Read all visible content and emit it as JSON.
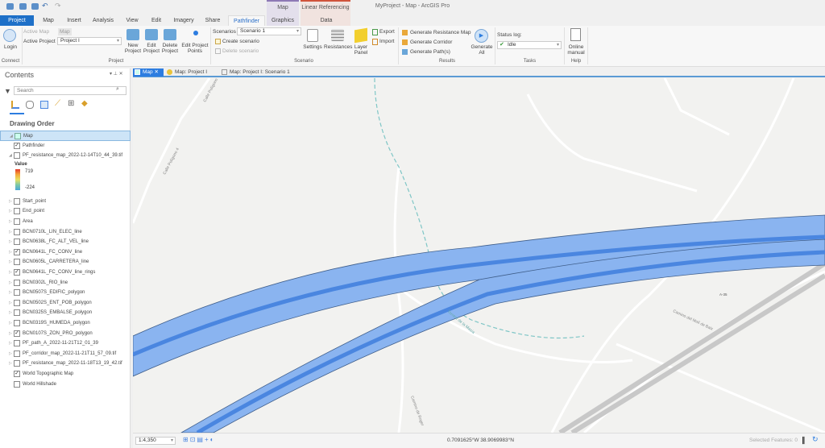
{
  "window": {
    "title": "MyProject - Map - ArcGIS Pro"
  },
  "ribbon_tabs": [
    "Project",
    "Map",
    "Insert",
    "Analysis",
    "View",
    "Edit",
    "Imagery",
    "Share",
    "Pathfinder",
    "Graphics",
    "Data"
  ],
  "contextual": {
    "map": "Map",
    "linear_referencing": "Linear Referencing"
  },
  "ribbon": {
    "connect": {
      "login": "Login",
      "group": "Connect"
    },
    "project": {
      "active_map_label": "Active Map",
      "active_map_value": "Map",
      "active_project_label": "Active Project",
      "active_project_value": "Project I",
      "new": "New Project",
      "edit": "Edit Project",
      "delete": "Delete Project",
      "edit_points": "Edit Project Points",
      "group": "Project"
    },
    "scenario": {
      "scenarios_label": "Scenarios",
      "scenarios_value": "Scenario 1",
      "create": "Create scenario",
      "delete": "Delete scenario",
      "settings": "Settings",
      "resistances": "Resistances",
      "layer_panel": "Layer Panel",
      "export": "Export",
      "import": "Import",
      "group": "Scenario"
    },
    "results": {
      "resistance": "Generate Resistance Map",
      "corridor": "Generate Corridor",
      "paths": "Generate Path(s)",
      "generate_all": "Generate All",
      "group": "Results"
    },
    "tasks": {
      "status_label": "Status log:",
      "status_value": "Idle",
      "group": "Tasks"
    },
    "help": {
      "manual": "Online manual",
      "group": "Help"
    }
  },
  "doc_tabs": [
    "Map",
    "Map: Project I",
    "Map: Project I: Scenario 1"
  ],
  "contents": {
    "title": "Contents",
    "search_placeholder": "Search",
    "drawing_order": "Drawing Order",
    "legend": {
      "title": "Value",
      "high": "719",
      "low": "-224"
    },
    "layers": [
      {
        "name": "Map",
        "checked": null
      },
      {
        "name": "Pathfinder",
        "checked": true
      },
      {
        "name": "PF_resistance_map_2022-12-14T10_44_39.tif",
        "checked": false
      },
      {
        "name": "Start_point",
        "checked": false
      },
      {
        "name": "End_point",
        "checked": false
      },
      {
        "name": "Area",
        "checked": false
      },
      {
        "name": "BCN0710L_LIN_ELEC_line",
        "checked": false
      },
      {
        "name": "BCN0638L_FC_ALT_VEL_line",
        "checked": false
      },
      {
        "name": "BCN0641L_FC_CONV_line",
        "checked": true
      },
      {
        "name": "BCN0605L_CARRETERA_line",
        "checked": false
      },
      {
        "name": "BCN0641L_FC_CONV_line_rings",
        "checked": true
      },
      {
        "name": "BCN0302L_RIO_line",
        "checked": false
      },
      {
        "name": "BCN0507S_EDIFIC_polygon",
        "checked": false
      },
      {
        "name": "BCN0502S_ENT_POB_polygon",
        "checked": false
      },
      {
        "name": "BCN0325S_EMBALSE_polygon",
        "checked": false
      },
      {
        "name": "BCN0319S_HUMEDA_polygon",
        "checked": false
      },
      {
        "name": "BCN0107S_ZON_PRO_polygon",
        "checked": true
      },
      {
        "name": "PF_path_A_2022-11-21T12_01_39",
        "checked": false
      },
      {
        "name": "PF_corridor_map_2022-11-21T11_57_09.tif",
        "checked": false
      },
      {
        "name": "PF_resistance_map_2022-11-18T13_19_42.tif",
        "checked": false
      },
      {
        "name": "World Topographic Map",
        "checked": true
      },
      {
        "name": "World Hillshade",
        "checked": false
      }
    ]
  },
  "map": {
    "labels": {
      "road1": "Calle Polígono 4",
      "road2": "Calle Polígono",
      "road3": "Camino del Molí de Baix",
      "road4": "Camino de Roger",
      "stream": "Torrent de la Masia",
      "hwy": "A-35"
    }
  },
  "status": {
    "scale": "1:4,350",
    "coords": "0.7091625°W 38.9069983°N",
    "selected": "Selected Features: 0"
  },
  "colors": {
    "accent": "#1e70c8",
    "corridor": "#8ab4f0",
    "corridor_core": "#4a86e0"
  }
}
